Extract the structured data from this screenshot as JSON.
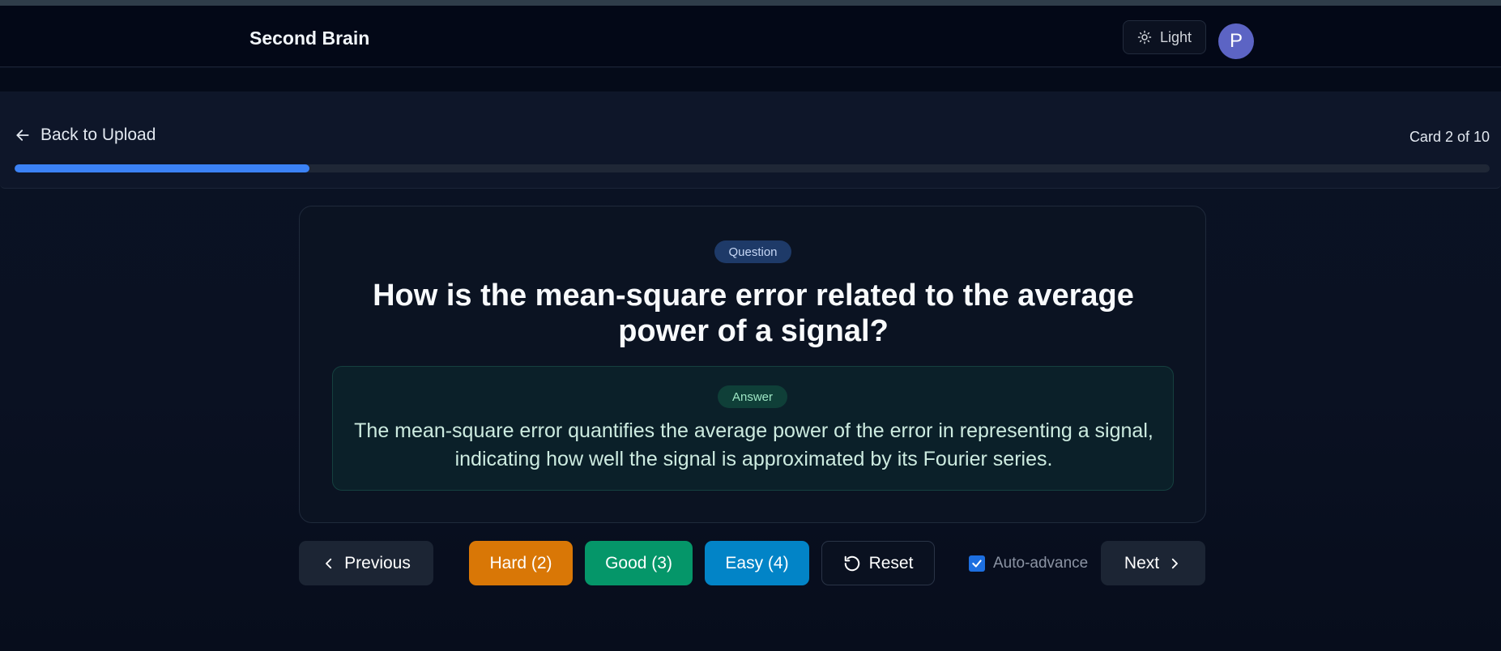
{
  "app": {
    "title": "Second Brain"
  },
  "header": {
    "theme_toggle_label": "Light",
    "avatar_initial": "P"
  },
  "progress": {
    "back_label": "Back to Upload",
    "counter_text": "Card 2 of 10",
    "fraction": 0.2
  },
  "card": {
    "question_badge": "Question",
    "question_text": "How is the mean-square error related to the average power of a signal?",
    "answer_badge": "Answer",
    "answer_text": "The mean-square error quantifies the average power of the error in representing a signal, indicating how well the signal is approximated by its Fourier series."
  },
  "controls": {
    "previous_label": "Previous",
    "hard_label": "Hard (2)",
    "good_label": "Good (3)",
    "easy_label": "Easy (4)",
    "reset_label": "Reset",
    "auto_advance_label": "Auto-advance",
    "auto_advance_checked": true,
    "next_label": "Next"
  },
  "colors": {
    "accent_blue": "#3b82f6",
    "hard": "#d97706",
    "good": "#059669",
    "easy": "#0284c7",
    "avatar": "#5c64c4"
  },
  "icons": {
    "theme": "sun-icon",
    "back": "arrow-left-icon",
    "previous": "chevron-left-icon",
    "reset": "rotate-ccw-icon",
    "next": "chevron-right-icon"
  }
}
